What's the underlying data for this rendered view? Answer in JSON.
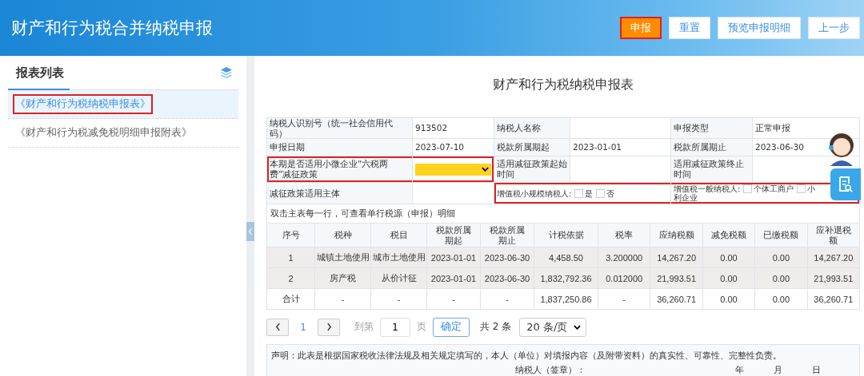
{
  "header": {
    "title": "财产和行为税合并纳税申报",
    "buttons": [
      {
        "label": "申报",
        "kind": "primary",
        "highlighted": true
      },
      {
        "label": "重置",
        "kind": "default",
        "highlighted": false
      },
      {
        "label": "预览申报明细",
        "kind": "default",
        "highlighted": false
      },
      {
        "label": "上一步",
        "kind": "default",
        "highlighted": false
      }
    ]
  },
  "sidebar": {
    "title": "报表列表",
    "items": [
      {
        "label": "《财产和行为税纳税申报表》",
        "selected": true,
        "highlighted": true
      },
      {
        "label": "《财产和行为税减免税明细申报附表》",
        "selected": false,
        "highlighted": false
      }
    ]
  },
  "form": {
    "title": "财产和行为税纳税申报表",
    "rows": [
      {
        "cells": [
          {
            "kind": "label",
            "text": "纳税人识别号（统一社会信用代码）",
            "highlighted": false
          },
          {
            "kind": "value",
            "text": "913502",
            "highlighted": false
          },
          {
            "kind": "label",
            "text": "纳税人名称",
            "highlighted": false
          },
          {
            "kind": "value",
            "highlighted": false
          },
          {
            "kind": "label",
            "text": "申报类型",
            "highlighted": false
          },
          {
            "kind": "value",
            "text": "正常申报",
            "highlighted": false
          }
        ]
      },
      {
        "cells": [
          {
            "kind": "label",
            "text": "申报日期",
            "highlighted": false
          },
          {
            "kind": "value",
            "text": "2023-07-10",
            "highlighted": false
          },
          {
            "kind": "label",
            "text": "税款所属期起",
            "highlighted": false
          },
          {
            "kind": "value",
            "text": "2023-01-01",
            "highlighted": false
          },
          {
            "kind": "label",
            "text": "税款所属期止",
            "highlighted": false
          },
          {
            "kind": "value",
            "text": "2023-06-30",
            "highlighted": false
          }
        ]
      },
      {
        "cells": [
          {
            "kind": "label",
            "text": "本期是否适用小微企业“六税两费”减征政策",
            "highlighted": true
          },
          {
            "kind": "select",
            "highlighted": true
          },
          {
            "kind": "label",
            "text": "适用减征政策起始时间",
            "highlighted": false
          },
          {
            "kind": "value",
            "highlighted": false
          },
          {
            "kind": "label",
            "text": "适用减征政策终止时间",
            "highlighted": false
          },
          {
            "kind": "value",
            "highlighted": false
          }
        ]
      },
      {
        "cells": [
          {
            "kind": "label",
            "text": "减征政策适用主体",
            "highlighted": false
          },
          {
            "kind": "value",
            "highlighted": false
          },
          {
            "kind": "checks",
            "colspan": 2,
            "text": "增值税小规模纳税人:",
            "highlighted": true,
            "options": [
              {
                "label": "是",
                "checked": false
              },
              {
                "label": "否",
                "checked": false
              }
            ]
          },
          {
            "kind": "checks",
            "colspan": 2,
            "text": "增值税一般纳税人:",
            "highlighted": true,
            "options": [
              {
                "label": "个体工商户",
                "checked": false
              },
              {
                "label": "小",
                "checked": false
              }
            ],
            "continuation": "利企业"
          }
        ]
      }
    ],
    "note": "双击主表每一行，可查看单行税源（申报）明细"
  },
  "detail": {
    "columns": [
      "序号",
      "税种",
      "税目",
      "税款所属期起",
      "税款所属期止",
      "计税依据",
      "税率",
      "应纳税额",
      "减免税额",
      "已缴税额",
      "应补退税额"
    ],
    "rows": [
      {
        "kind": "item",
        "cells": [
          "1",
          "城镇土地使用",
          "城市土地使用",
          "2023-01-01",
          "2023-06-30",
          "4,458.50",
          "3.200000",
          "14,267.20",
          "0.00",
          "0.00",
          "14,267.20"
        ]
      },
      {
        "kind": "item",
        "cells": [
          "2",
          "房产税",
          "从价计征",
          "2023-01-01",
          "2023-06-30",
          "1,832,792.36",
          "0.012000",
          "21,993.51",
          "0.00",
          "0.00",
          "21,993.51"
        ]
      },
      {
        "kind": "total",
        "cells": [
          "合计",
          "-",
          "-",
          "-",
          "-",
          "1,837,250.86",
          "-",
          "36,260.71",
          "0.00",
          "0.00",
          "36,260.71"
        ]
      }
    ]
  },
  "pagination": {
    "pages": [
      {
        "label": "1",
        "selected": true
      }
    ],
    "goto_label": "到第",
    "goto_value": "1",
    "page_unit": "页",
    "confirm": "确定",
    "total": "共 2 条",
    "page_size": "20 条/页"
  },
  "declaration": {
    "text": "声明：此表是根据国家税收法律法规及相关规定填写的，本人（单位）对填报内容（及附带资料）的真实性、可靠性、完整性负责。",
    "signer": "纳税人（签章）：",
    "year": "年",
    "month": "月",
    "day": "日"
  }
}
